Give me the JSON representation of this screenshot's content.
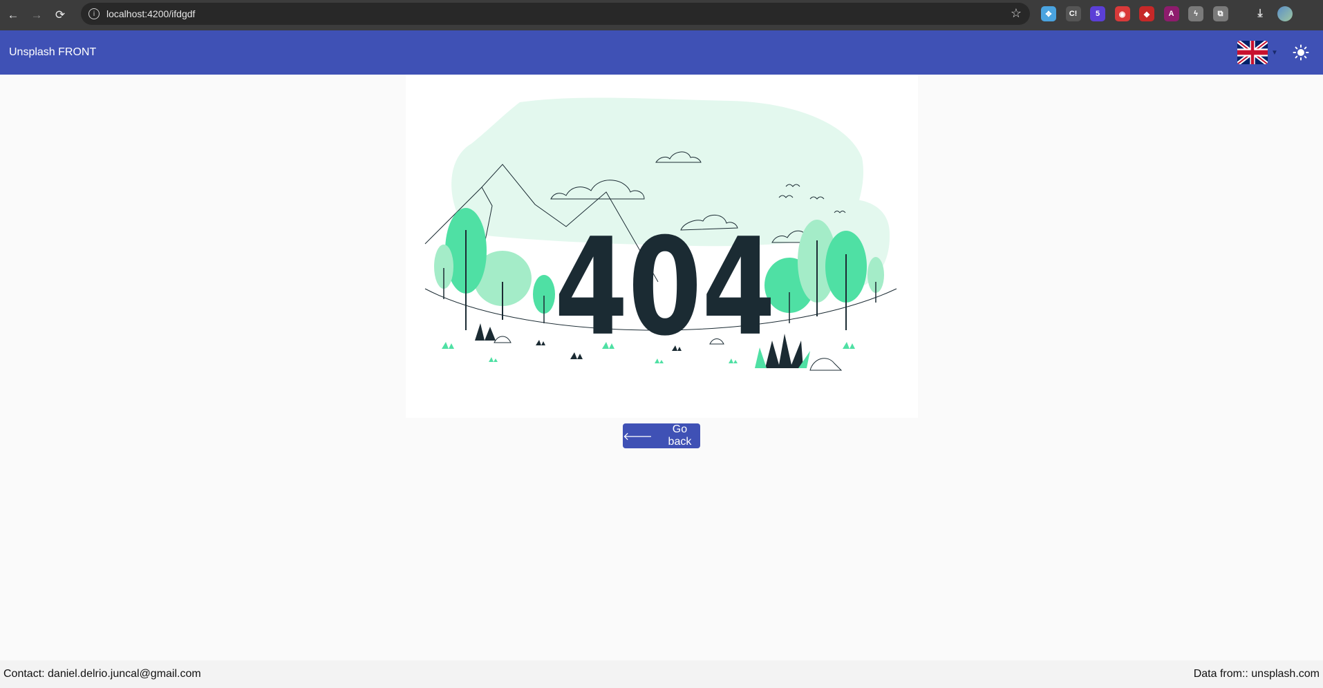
{
  "browser": {
    "url": "localhost:4200/ifdgdf",
    "back_icon": "←",
    "forward_icon": "→",
    "reload_icon": "⟳",
    "star_icon": "☆",
    "extensions": [
      {
        "name": "crystal-extension-icon",
        "color": "#4aa3df",
        "glyph": "✥"
      },
      {
        "name": "ci-extension-icon",
        "color": "#555555",
        "glyph": "C!"
      },
      {
        "name": "badge-extension-icon",
        "color": "#5b3fd6",
        "glyph": "5"
      },
      {
        "name": "shield-extension-icon",
        "color": "#d93a3a",
        "glyph": "◉"
      },
      {
        "name": "diamond-extension-icon",
        "color": "#c62828",
        "glyph": "◆"
      },
      {
        "name": "angular-extension-icon",
        "color": "#8e1c6d",
        "glyph": "A"
      },
      {
        "name": "bolt-extension-icon",
        "color": "#7a7a7a",
        "glyph": "ϟ"
      },
      {
        "name": "puzzle-extension-icon",
        "color": "#7a7a7a",
        "glyph": "⧉"
      }
    ]
  },
  "appbar": {
    "title": "Unsplash FRONT",
    "language_caret": "▼"
  },
  "error": {
    "code": "404",
    "button_label": "Go back",
    "button_icon": "🡐"
  },
  "footer": {
    "contact": "Contact: daniel.delrio.juncal@gmail.com",
    "source": "Data from:: unsplash.com"
  },
  "colors": {
    "primary": "#3f51b5",
    "accent_green": "#4fe0a4",
    "light_green": "#e3f8ee",
    "dark_text": "#1b2b33"
  }
}
